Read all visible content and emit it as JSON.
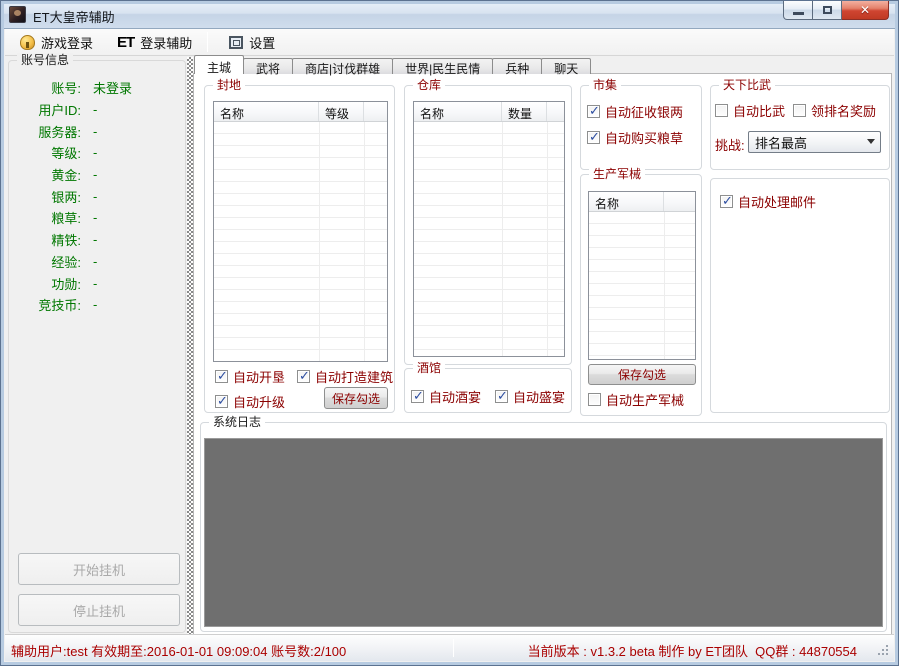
{
  "colors": {
    "group_title_maroon": "#8b0000",
    "account_green": "#007700",
    "status_red": "#aa0000",
    "log_bg": "#6f6f6f",
    "close_button_red": "#c03a24",
    "check_blue": "#2c4da0"
  },
  "window": {
    "title": "ET大皇帝辅助"
  },
  "toolbar": {
    "game_login": "游戏登录",
    "et_logo": "ET",
    "login_helper": "登录辅助",
    "settings": "设置"
  },
  "account": {
    "title": "账号信息",
    "fields": [
      {
        "label": "账号:",
        "value": "未登录"
      },
      {
        "label": "用户ID:",
        "value": "-"
      },
      {
        "label": "服务器:",
        "value": "-"
      },
      {
        "label": "等级:",
        "value": "-"
      },
      {
        "label": "黄金:",
        "value": "-"
      },
      {
        "label": "银两:",
        "value": "-"
      },
      {
        "label": "粮草:",
        "value": "-"
      },
      {
        "label": "精铁:",
        "value": "-"
      },
      {
        "label": "经验:",
        "value": "-"
      },
      {
        "label": "功勋:",
        "value": "-"
      },
      {
        "label": "竞技币:",
        "value": "-"
      }
    ],
    "start_button": "开始挂机",
    "stop_button": "停止挂机"
  },
  "tabs": [
    {
      "label": "主城",
      "active": true
    },
    {
      "label": "武将",
      "active": false
    },
    {
      "label": "商店|讨伐群雄",
      "active": false
    },
    {
      "label": "世界|民生民情",
      "active": false
    },
    {
      "label": "兵种",
      "active": false
    },
    {
      "label": "聊天",
      "active": false
    }
  ],
  "main": {
    "fief": {
      "title": "封地",
      "columns": [
        "名称",
        "等级"
      ],
      "checks": [
        {
          "label": "自动开垦",
          "checked": true
        },
        {
          "label": "自动打造建筑",
          "checked": true
        },
        {
          "label": "自动升级",
          "checked": true
        }
      ],
      "save_button": "保存勾选"
    },
    "warehouse": {
      "title": "仓库",
      "columns": [
        "名称",
        "数量"
      ]
    },
    "tavern": {
      "title": "酒馆",
      "checks": [
        {
          "label": "自动酒宴",
          "checked": true
        },
        {
          "label": "自动盛宴",
          "checked": true
        }
      ]
    },
    "market": {
      "title": "市集",
      "checks": [
        {
          "label": "自动征收银两",
          "checked": true
        },
        {
          "label": "自动购买粮草",
          "checked": true
        }
      ]
    },
    "ordnance": {
      "title": "生产军械",
      "columns": [
        "名称"
      ],
      "save_button": "保存勾选",
      "check": {
        "label": "自动生产军械",
        "checked": false
      }
    },
    "duel": {
      "title": "天下比武",
      "checks": [
        {
          "label": "自动比武",
          "checked": false
        },
        {
          "label": "领排名奖励",
          "checked": false
        }
      ],
      "challenge_label": "挑战:",
      "challenge_value": "排名最高"
    },
    "mail": {
      "check": {
        "label": "自动处理邮件",
        "checked": true
      }
    },
    "log": {
      "title": "系统日志"
    }
  },
  "statusbar": {
    "left": "辅助用户:test 有效期至:2016-01-01 09:09:04 账号数:2/100",
    "version": "当前版本 : v1.3.2  beta  制作 by ET团队",
    "qq": "QQ群 : 44870554"
  }
}
